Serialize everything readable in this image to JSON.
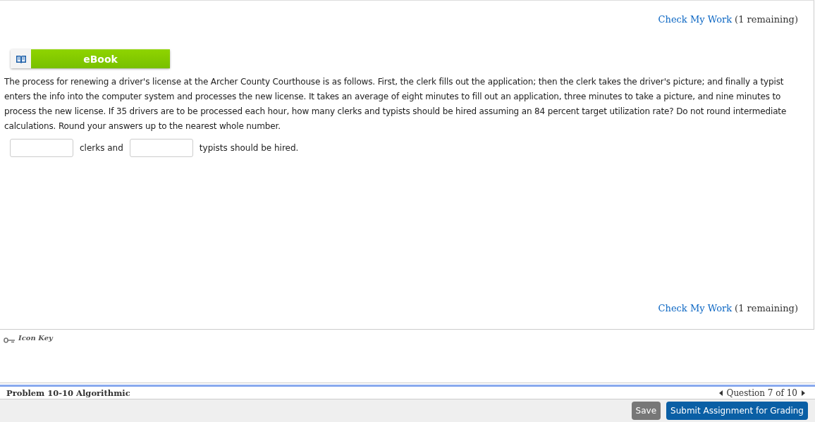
{
  "check_top": {
    "link": "Check My Work",
    "note": "(1 remaining)"
  },
  "ebook": {
    "label": "eBook"
  },
  "question": "The process for renewing a driver's license at the Archer County Courthouse is as follows. First, the clerk fills out the application; then the clerk takes the driver's picture; and finally a typist enters the info into the computer system and processes the new license. It takes an average of eight minutes to fill out an application, three minutes to take a picture, and nine minutes to process the new license. If 35 drivers are to be processed each hour, how many clerks and typists should be hired assuming an 84 percent target utilization rate? Do not round intermediate calculations. Round your answers up to the nearest whole number.",
  "answer_row": [
    {
      "kind": "field"
    },
    {
      "kind": "text",
      "text": "clerks and"
    },
    {
      "kind": "field"
    },
    {
      "kind": "text",
      "text": "typists should be hired."
    }
  ],
  "check_bottom": {
    "link": "Check My Work",
    "note": "(1 remaining)"
  },
  "icon_key": "Icon Key",
  "footer": {
    "problem": "Problem 10-10 Algorithmic",
    "question_nav": "Question 7 of 10"
  },
  "buttons": [
    {
      "kind": "secondary",
      "label": "Save"
    },
    {
      "kind": "primary",
      "label": "Submit Assignment for Grading"
    }
  ]
}
